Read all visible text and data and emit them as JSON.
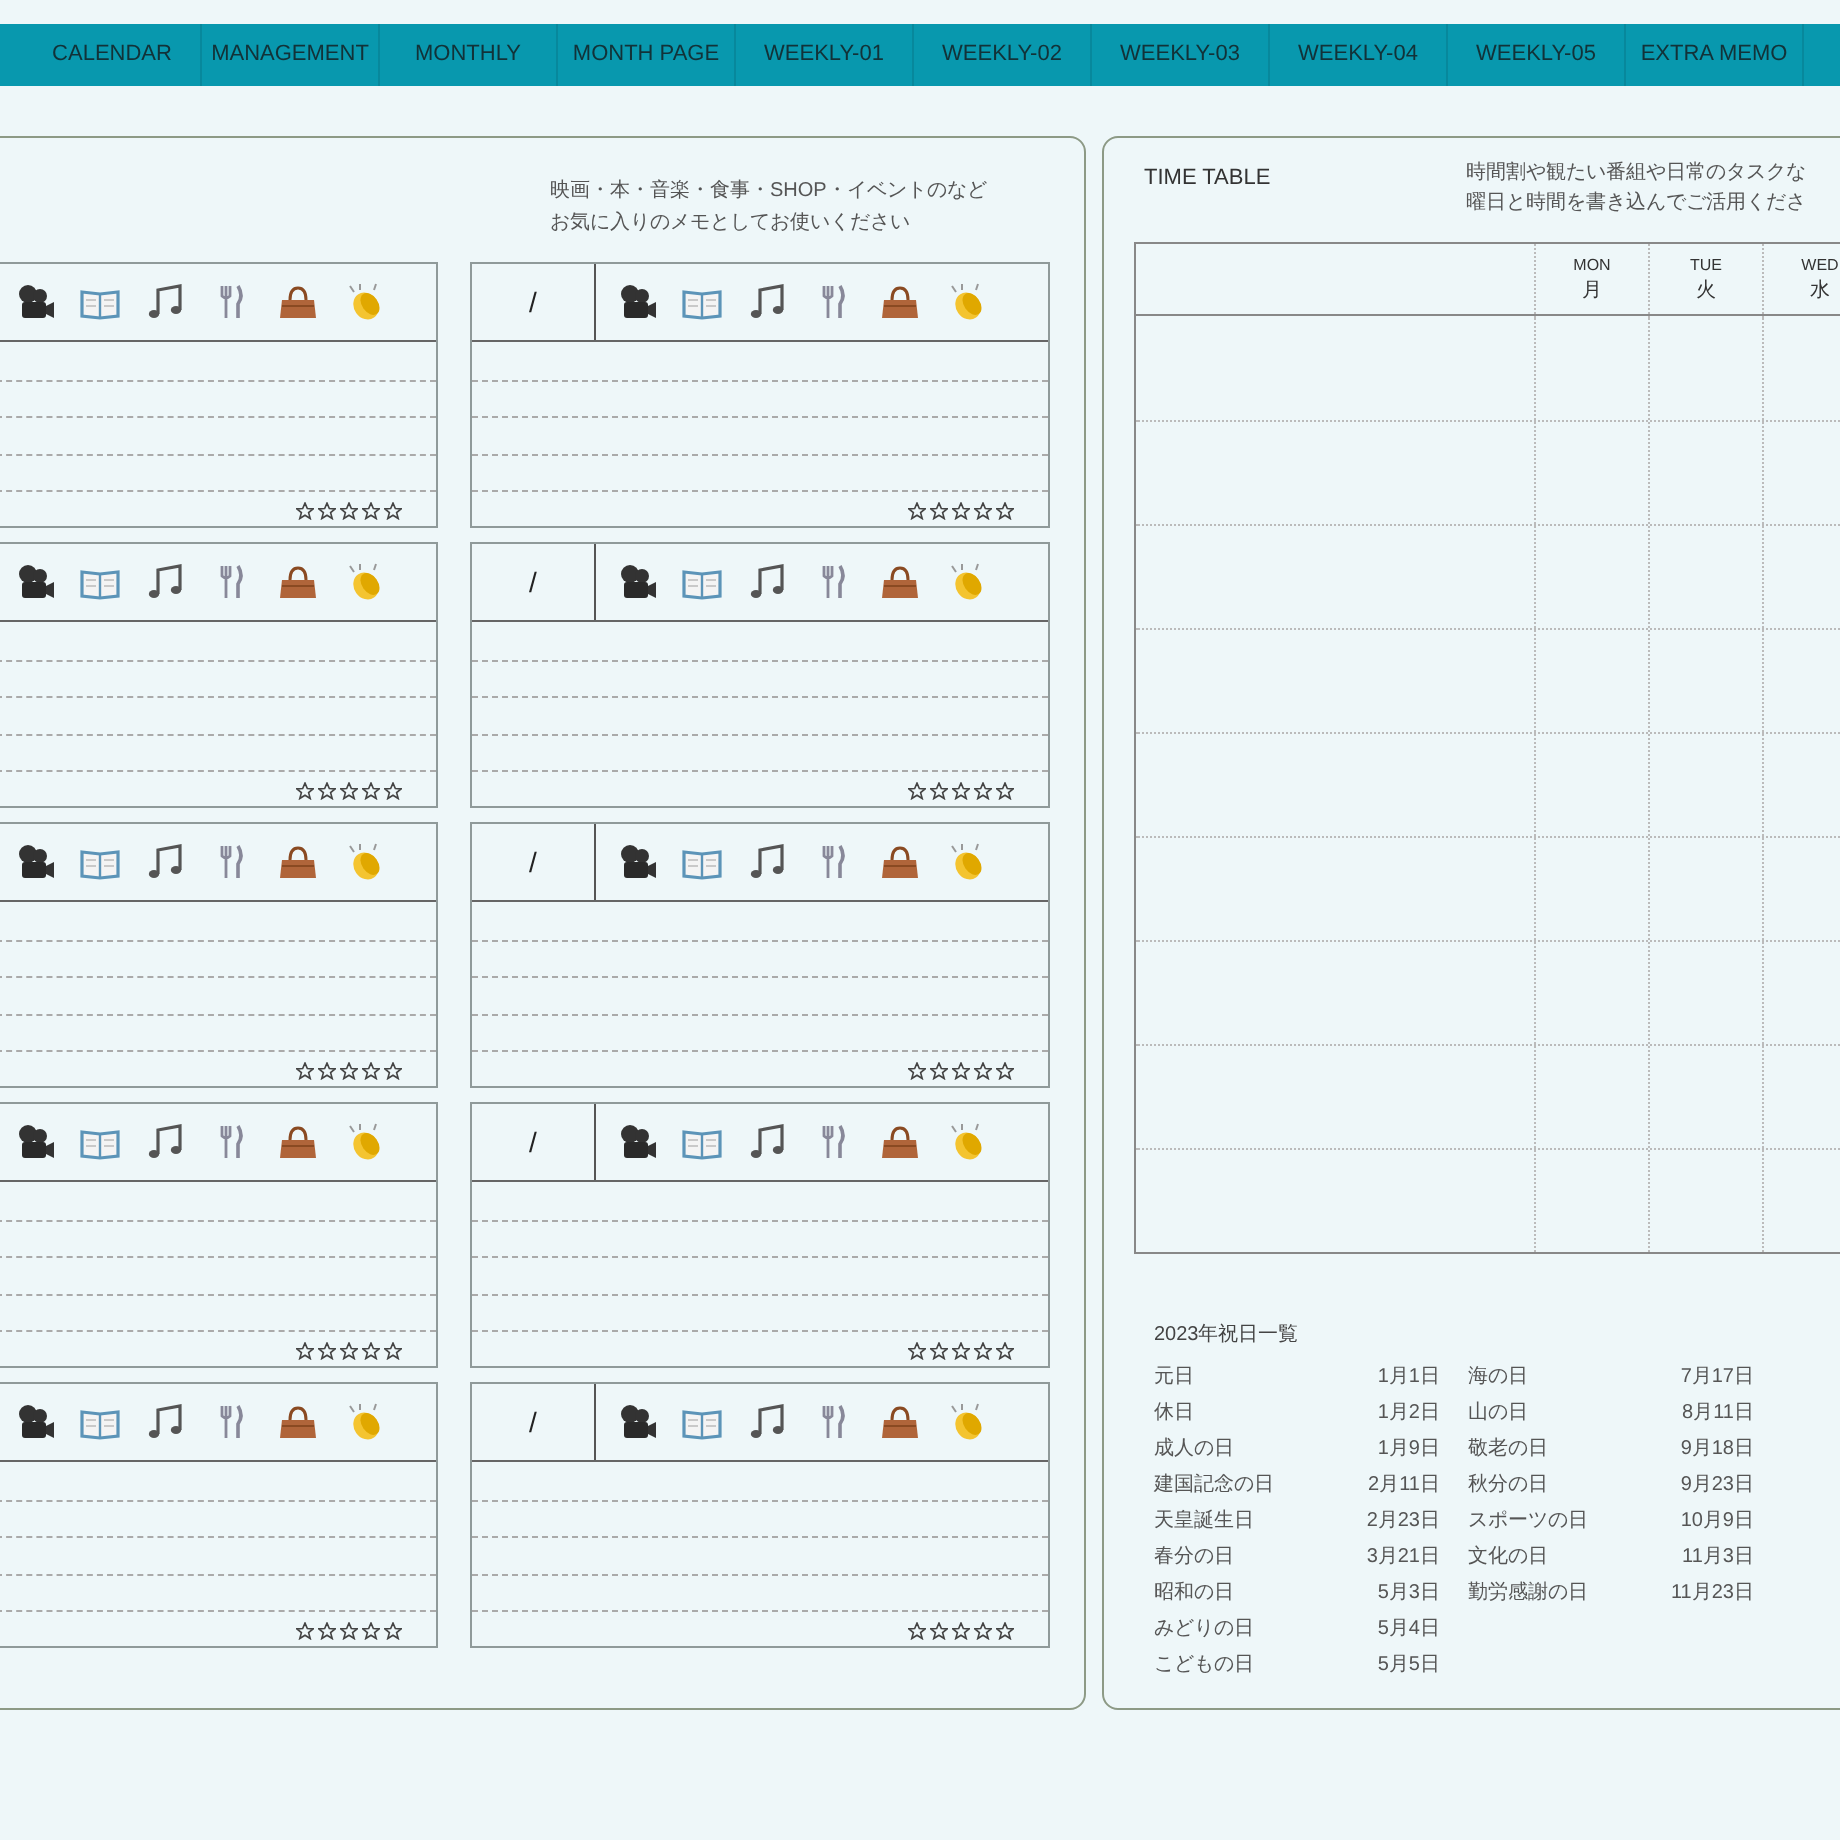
{
  "tabs": [
    {
      "label": "CALENDAR"
    },
    {
      "label": "MANAGEMENT"
    },
    {
      "label": "MONTHLY"
    },
    {
      "label": "MONTH PAGE"
    },
    {
      "label": "WEEKLY-01"
    },
    {
      "label": "WEEKLY-02"
    },
    {
      "label": "WEEKLY-03"
    },
    {
      "label": "WEEKLY-04"
    },
    {
      "label": "WEEKLY-05"
    },
    {
      "label": "EXTRA MEMO"
    }
  ],
  "memo": {
    "note": [
      "映画・本・音楽・食事・SHOP・イベントのなど",
      "お気に入りのメモとしてお使いください"
    ],
    "cards": [
      {
        "stars": 0
      },
      {
        "date": "/",
        "stars": 0
      },
      {
        "stars": 0
      },
      {
        "date": "/",
        "stars": 0
      },
      {
        "stars": 0
      },
      {
        "date": "/",
        "stars": 0
      },
      {
        "stars": 0
      },
      {
        "date": "/",
        "stars": 0
      },
      {
        "stars": 0
      },
      {
        "date": "/",
        "stars": 0
      }
    ]
  },
  "timetable": {
    "title": "TIME TABLE",
    "note": [
      "時間割や観たい番組や日常のタスクな",
      "曜日と時間を書き込んでご活用くださ"
    ],
    "days": [
      {
        "en": "MON",
        "ja": "月"
      },
      {
        "en": "TUE",
        "ja": "火"
      },
      {
        "en": "WED",
        "ja": "水"
      }
    ]
  },
  "holidays": {
    "title": "2023年祝日一覧",
    "columns": [
      [
        {
          "name": "元日",
          "date": "1月1日"
        },
        {
          "name": "休日",
          "date": "1月2日"
        },
        {
          "name": "成人の日",
          "date": "1月9日"
        },
        {
          "name": "建国記念の日",
          "date": "2月11日"
        },
        {
          "name": "天皇誕生日",
          "date": "2月23日"
        },
        {
          "name": "春分の日",
          "date": "3月21日"
        },
        {
          "name": "昭和の日",
          "date": "5月3日"
        },
        {
          "name": "みどりの日",
          "date": "5月4日"
        },
        {
          "name": "こどもの日",
          "date": "5月5日"
        }
      ],
      [
        {
          "name": "海の日",
          "date": "7月17日"
        },
        {
          "name": "山の日",
          "date": "8月11日"
        },
        {
          "name": "敬老の日",
          "date": "9月18日"
        },
        {
          "name": "秋分の日",
          "date": "9月23日"
        },
        {
          "name": "スポーツの日",
          "date": "10月9日"
        },
        {
          "name": "文化の日",
          "date": "11月3日"
        },
        {
          "name": "勤労感謝の日",
          "date": "11月23日"
        }
      ]
    ]
  }
}
